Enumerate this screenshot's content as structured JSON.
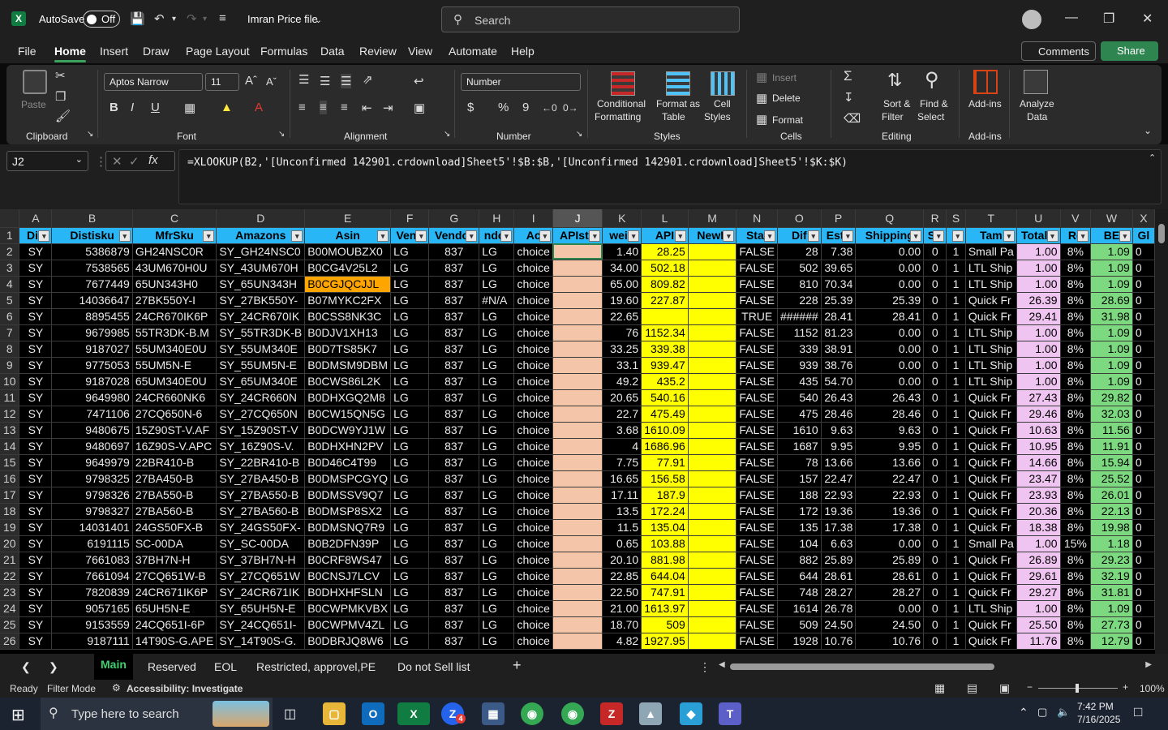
{
  "titlebar": {
    "autosave_label": "AutoSave",
    "autosave_state": "Off",
    "file_name": "Imran Price file",
    "search_placeholder": "Search"
  },
  "menu": {
    "items": [
      "File",
      "Home",
      "Insert",
      "Draw",
      "Page Layout",
      "Formulas",
      "Data",
      "Review",
      "View",
      "Automate",
      "Help"
    ],
    "active": "Home",
    "comments_label": "Comments",
    "share_label": "Share"
  },
  "ribbon": {
    "clipboard": {
      "paste": "Paste",
      "group": "Clipboard"
    },
    "font": {
      "family": "Aptos Narrow",
      "size": "11",
      "group": "Font",
      "bold": "B",
      "italic": "I",
      "underline": "U"
    },
    "alignment": {
      "group": "Alignment"
    },
    "number": {
      "format": "Number",
      "group": "Number",
      "currency": "$",
      "percent": "%",
      "comma": "9"
    },
    "styles": {
      "conditional": "Conditional",
      "conditional2": "Formatting",
      "format_as": "Format as",
      "format_as2": "Table",
      "cell": "Cell",
      "cell2": "Styles",
      "group": "Styles"
    },
    "cells": {
      "insert": "Insert",
      "delete": "Delete",
      "format": "Format",
      "group": "Cells"
    },
    "editing": {
      "sort": "Sort &",
      "sort2": "Filter",
      "find": "Find &",
      "find2": "Select",
      "group": "Editing"
    },
    "addins": {
      "label": "Add-ins",
      "group": "Add-ins"
    },
    "analyze": {
      "label": "Analyze",
      "label2": "Data"
    }
  },
  "formula_bar": {
    "name_box": "J2",
    "formula": "=XLOOKUP(B2,'[Unconfirmed 142901.crdownload]Sheet5'!$B:$B,'[Unconfirmed 142901.crdownload]Sheet5'!$K:$K)"
  },
  "sheet": {
    "columns": [
      "A",
      "B",
      "C",
      "D",
      "E",
      "F",
      "G",
      "H",
      "I",
      "J",
      "K",
      "L",
      "M",
      "N",
      "O",
      "P",
      "Q",
      "R",
      "S",
      "T",
      "U",
      "V",
      "W",
      "X"
    ],
    "headers": [
      "Dis",
      "Distisku",
      "MfrSku",
      "Amazons",
      "Asin",
      "Vend",
      "Vendor",
      "ndor",
      "Ac",
      "APIsto",
      "weig",
      "API",
      "NewF",
      "Stat",
      "Dif",
      "Ests",
      "Shipping",
      "Su",
      "H",
      "Tam",
      "TotalC",
      "Re",
      "BE",
      "Gl"
    ],
    "rows": [
      [
        "2",
        "SY",
        "5386879",
        "GH24NSC0R",
        "SY_GH24NSC0",
        "B00MOUBZX0",
        "LG",
        "837",
        "LG",
        "choice",
        "",
        "1.40",
        "28.25",
        "",
        "FALSE",
        "28",
        "7.38",
        "0.00",
        "0",
        "1",
        "Small Pa",
        "1.00",
        "8%",
        "1.09",
        "0"
      ],
      [
        "3",
        "SY",
        "7538565",
        "43UM670H0U",
        "SY_43UM670H",
        "B0CG4V25L2",
        "LG",
        "837",
        "LG",
        "choice",
        "",
        "34.00",
        "502.18",
        "",
        "FALSE",
        "502",
        "39.65",
        "0.00",
        "0",
        "1",
        "LTL Ship",
        "1.00",
        "8%",
        "1.09",
        "0"
      ],
      [
        "4",
        "SY",
        "7677449",
        "65UN343H0",
        "SY_65UN343H",
        "B0CGJQCJJL",
        "LG",
        "837",
        "LG",
        "choice",
        "",
        "65.00",
        "809.82",
        "",
        "FALSE",
        "810",
        "70.34",
        "0.00",
        "0",
        "1",
        "LTL Ship",
        "1.00",
        "8%",
        "1.09",
        "0"
      ],
      [
        "5",
        "SY",
        "14036647",
        "27BK550Y-I",
        "SY_27BK550Y-",
        "B07MYKC2FX",
        "LG",
        "837",
        "#N/A",
        "choice",
        "",
        "19.60",
        "227.87",
        "",
        "FALSE",
        "228",
        "25.39",
        "25.39",
        "0",
        "1",
        "Quick Fr",
        "26.39",
        "8%",
        "28.69",
        "0"
      ],
      [
        "6",
        "SY",
        "8895455",
        "24CR670IK6P",
        "SY_24CR670IK",
        "B0CSS8NK3C",
        "LG",
        "837",
        "LG",
        "choice",
        "",
        "22.65",
        "",
        "",
        "TRUE",
        "######",
        "28.41",
        "28.41",
        "0",
        "1",
        "Quick Fr",
        "29.41",
        "8%",
        "31.98",
        "0"
      ],
      [
        "7",
        "SY",
        "9679985",
        "55TR3DK-B.M",
        "SY_55TR3DK-B",
        "B0DJV1XH13",
        "LG",
        "837",
        "LG",
        "choice",
        "",
        "76",
        "1152.34",
        "",
        "FALSE",
        "1152",
        "81.23",
        "0.00",
        "0",
        "1",
        "LTL Ship",
        "1.00",
        "8%",
        "1.09",
        "0"
      ],
      [
        "8",
        "SY",
        "9187027",
        "55UM340E0U",
        "SY_55UM340E",
        "B0D7TS85K7",
        "LG",
        "837",
        "LG",
        "choice",
        "",
        "33.25",
        "339.38",
        "",
        "FALSE",
        "339",
        "38.91",
        "0.00",
        "0",
        "1",
        "LTL Ship",
        "1.00",
        "8%",
        "1.09",
        "0"
      ],
      [
        "9",
        "SY",
        "9775053",
        "55UM5N-E",
        "SY_55UM5N-E",
        "B0DMSM9DBM",
        "LG",
        "837",
        "LG",
        "choice",
        "",
        "33.1",
        "939.47",
        "",
        "FALSE",
        "939",
        "38.76",
        "0.00",
        "0",
        "1",
        "LTL Ship",
        "1.00",
        "8%",
        "1.09",
        "0"
      ],
      [
        "10",
        "SY",
        "9187028",
        "65UM340E0U",
        "SY_65UM340E",
        "B0CWS86L2K",
        "LG",
        "837",
        "LG",
        "choice",
        "",
        "49.2",
        "435.2",
        "",
        "FALSE",
        "435",
        "54.70",
        "0.00",
        "0",
        "1",
        "LTL Ship",
        "1.00",
        "8%",
        "1.09",
        "0"
      ],
      [
        "11",
        "SY",
        "9649980",
        "24CR660NK6",
        "SY_24CR660N",
        "B0DHXGQ2M8",
        "LG",
        "837",
        "LG",
        "choice",
        "",
        "20.65",
        "540.16",
        "",
        "FALSE",
        "540",
        "26.43",
        "26.43",
        "0",
        "1",
        "Quick Fr",
        "27.43",
        "8%",
        "29.82",
        "0"
      ],
      [
        "12",
        "SY",
        "7471106",
        "27CQ650N-6",
        "SY_27CQ650N",
        "B0CW15QN5G",
        "LG",
        "837",
        "LG",
        "choice",
        "",
        "22.7",
        "475.49",
        "",
        "FALSE",
        "475",
        "28.46",
        "28.46",
        "0",
        "1",
        "Quick Fr",
        "29.46",
        "8%",
        "32.03",
        "0"
      ],
      [
        "13",
        "SY",
        "9480675",
        "15Z90ST-V.AF",
        "SY_15Z90ST-V",
        "B0DCW9YJ1W",
        "LG",
        "837",
        "LG",
        "choice",
        "",
        "3.68",
        "1610.09",
        "",
        "FALSE",
        "1610",
        "9.63",
        "9.63",
        "0",
        "1",
        "Quick Fr",
        "10.63",
        "8%",
        "11.56",
        "0"
      ],
      [
        "14",
        "SY",
        "9480697",
        "16Z90S-V.APC",
        "SY_16Z90S-V.",
        "B0DHXHN2PV",
        "LG",
        "837",
        "LG",
        "choice",
        "",
        "4",
        "1686.96",
        "",
        "FALSE",
        "1687",
        "9.95",
        "9.95",
        "0",
        "1",
        "Quick Fr",
        "10.95",
        "8%",
        "11.91",
        "0"
      ],
      [
        "15",
        "SY",
        "9649979",
        "22BR410-B",
        "SY_22BR410-B",
        "B0D46C4T99",
        "LG",
        "837",
        "LG",
        "choice",
        "",
        "7.75",
        "77.91",
        "",
        "FALSE",
        "78",
        "13.66",
        "13.66",
        "0",
        "1",
        "Quick Fr",
        "14.66",
        "8%",
        "15.94",
        "0"
      ],
      [
        "16",
        "SY",
        "9798325",
        "27BA450-B",
        "SY_27BA450-B",
        "B0DMSPCGYQ",
        "LG",
        "837",
        "LG",
        "choice",
        "",
        "16.65",
        "156.58",
        "",
        "FALSE",
        "157",
        "22.47",
        "22.47",
        "0",
        "1",
        "Quick Fr",
        "23.47",
        "8%",
        "25.52",
        "0"
      ],
      [
        "17",
        "SY",
        "9798326",
        "27BA550-B",
        "SY_27BA550-B",
        "B0DMSSV9Q7",
        "LG",
        "837",
        "LG",
        "choice",
        "",
        "17.11",
        "187.9",
        "",
        "FALSE",
        "188",
        "22.93",
        "22.93",
        "0",
        "1",
        "Quick Fr",
        "23.93",
        "8%",
        "26.01",
        "0"
      ],
      [
        "18",
        "SY",
        "9798327",
        "27BA560-B",
        "SY_27BA560-B",
        "B0DMSP8SX2",
        "LG",
        "837",
        "LG",
        "choice",
        "",
        "13.5",
        "172.24",
        "",
        "FALSE",
        "172",
        "19.36",
        "19.36",
        "0",
        "1",
        "Quick Fr",
        "20.36",
        "8%",
        "22.13",
        "0"
      ],
      [
        "19",
        "SY",
        "14031401",
        "24GS50FX-B",
        "SY_24GS50FX-",
        "B0DMSNQ7R9",
        "LG",
        "837",
        "LG",
        "choice",
        "",
        "11.5",
        "135.04",
        "",
        "FALSE",
        "135",
        "17.38",
        "17.38",
        "0",
        "1",
        "Quick Fr",
        "18.38",
        "8%",
        "19.98",
        "0"
      ],
      [
        "20",
        "SY",
        "6191115",
        "SC-00DA",
        "SY_SC-00DA",
        "B0B2DFN39P",
        "LG",
        "837",
        "LG",
        "choice",
        "",
        "0.65",
        "103.88",
        "",
        "FALSE",
        "104",
        "6.63",
        "0.00",
        "0",
        "1",
        "Small Pa",
        "1.00",
        "15%",
        "1.18",
        "0"
      ],
      [
        "21",
        "SY",
        "7661083",
        "37BH7N-H",
        "SY_37BH7N-H",
        "B0CRF8WS47",
        "LG",
        "837",
        "LG",
        "choice",
        "",
        "20.10",
        "881.98",
        "",
        "FALSE",
        "882",
        "25.89",
        "25.89",
        "0",
        "1",
        "Quick Fr",
        "26.89",
        "8%",
        "29.23",
        "0"
      ],
      [
        "22",
        "SY",
        "7661094",
        "27CQ651W-B",
        "SY_27CQ651W",
        "B0CNSJ7LCV",
        "LG",
        "837",
        "LG",
        "choice",
        "",
        "22.85",
        "644.04",
        "",
        "FALSE",
        "644",
        "28.61",
        "28.61",
        "0",
        "1",
        "Quick Fr",
        "29.61",
        "8%",
        "32.19",
        "0"
      ],
      [
        "23",
        "SY",
        "7820839",
        "24CR671IK6P",
        "SY_24CR671IK",
        "B0DHXHFSLN",
        "LG",
        "837",
        "LG",
        "choice",
        "",
        "22.50",
        "747.91",
        "",
        "FALSE",
        "748",
        "28.27",
        "28.27",
        "0",
        "1",
        "Quick Fr",
        "29.27",
        "8%",
        "31.81",
        "0"
      ],
      [
        "24",
        "SY",
        "9057165",
        "65UH5N-E",
        "SY_65UH5N-E",
        "B0CWPMKVBX",
        "LG",
        "837",
        "LG",
        "choice",
        "",
        "21.00",
        "1613.97",
        "",
        "FALSE",
        "1614",
        "26.78",
        "0.00",
        "0",
        "1",
        "LTL Ship",
        "1.00",
        "8%",
        "1.09",
        "0"
      ],
      [
        "25",
        "SY",
        "9153559",
        "24CQ651I-6P",
        "SY_24CQ651I-",
        "B0CWPMV4ZL",
        "LG",
        "837",
        "LG",
        "choice",
        "",
        "18.70",
        "509",
        "",
        "FALSE",
        "509",
        "24.50",
        "24.50",
        "0",
        "1",
        "Quick Fr",
        "25.50",
        "8%",
        "27.73",
        "0"
      ],
      [
        "26",
        "SY",
        "9187111",
        "14T90S-G.APE",
        "SY_14T90S-G.",
        "B0DBRJQ8W6",
        "LG",
        "837",
        "LG",
        "choice",
        "",
        "4.82",
        "1927.95",
        "",
        "FALSE",
        "1928",
        "10.76",
        "10.76",
        "0",
        "1",
        "Quick Fr",
        "11.76",
        "8%",
        "12.79",
        "0"
      ]
    ]
  },
  "sheet_tabs": [
    "Main",
    "Reserved",
    "EOL",
    "Restricted, approvel,PE",
    "Do not Sell list"
  ],
  "active_tab": "Main",
  "status": {
    "ready": "Ready",
    "filter": "Filter Mode",
    "accessibility": "Accessibility: Investigate",
    "zoom": "100%"
  },
  "taskbar": {
    "search_placeholder": "Type here to search",
    "time": "7:42 PM",
    "date": "7/16/2025",
    "badge": "4"
  },
  "colors": {
    "header_fill": "#29b6f6",
    "api_fill": "#ffff00",
    "apistock_fill": "#f4c5a8",
    "total_fill": "#efc4f0",
    "be_fill": "#7dd97f",
    "accent": "#107c41",
    "orange_cell": "#ffa500"
  }
}
